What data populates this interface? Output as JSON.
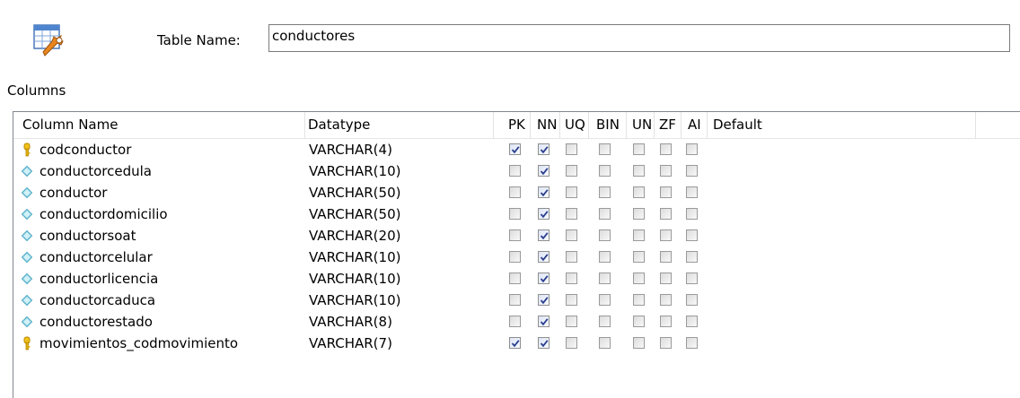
{
  "table": {
    "name_label": "Table Name:",
    "name_value": "conductores",
    "icon": "table-edit-icon"
  },
  "columns": {
    "section_label": "Columns",
    "headers": {
      "column_name": "Column Name",
      "datatype": "Datatype",
      "pk": "PK",
      "nn": "NN",
      "uq": "UQ",
      "bin": "BIN",
      "un": "UN",
      "zf": "ZF",
      "ai": "AI",
      "default": "Default"
    },
    "flag_keys": [
      "pk",
      "nn",
      "uq",
      "bin",
      "un",
      "zf",
      "ai"
    ],
    "rows": [
      {
        "name": "codconductor",
        "datatype": "VARCHAR(4)",
        "icon": "primary-key-icon",
        "flags": {
          "pk": true,
          "nn": true,
          "uq": false,
          "bin": false,
          "un": false,
          "zf": false,
          "ai": false
        },
        "default": ""
      },
      {
        "name": "conductorcedula",
        "datatype": "VARCHAR(10)",
        "icon": "column-diamond-icon",
        "flags": {
          "pk": false,
          "nn": true,
          "uq": false,
          "bin": false,
          "un": false,
          "zf": false,
          "ai": false
        },
        "default": ""
      },
      {
        "name": "conductor",
        "datatype": "VARCHAR(50)",
        "icon": "column-diamond-icon",
        "flags": {
          "pk": false,
          "nn": true,
          "uq": false,
          "bin": false,
          "un": false,
          "zf": false,
          "ai": false
        },
        "default": ""
      },
      {
        "name": "conductordomicilio",
        "datatype": "VARCHAR(50)",
        "icon": "column-diamond-icon",
        "flags": {
          "pk": false,
          "nn": true,
          "uq": false,
          "bin": false,
          "un": false,
          "zf": false,
          "ai": false
        },
        "default": ""
      },
      {
        "name": "conductorsoat",
        "datatype": "VARCHAR(20)",
        "icon": "column-diamond-icon",
        "flags": {
          "pk": false,
          "nn": true,
          "uq": false,
          "bin": false,
          "un": false,
          "zf": false,
          "ai": false
        },
        "default": ""
      },
      {
        "name": "conductorcelular",
        "datatype": "VARCHAR(10)",
        "icon": "column-diamond-icon",
        "flags": {
          "pk": false,
          "nn": true,
          "uq": false,
          "bin": false,
          "un": false,
          "zf": false,
          "ai": false
        },
        "default": ""
      },
      {
        "name": "conductorlicencia",
        "datatype": "VARCHAR(10)",
        "icon": "column-diamond-icon",
        "flags": {
          "pk": false,
          "nn": true,
          "uq": false,
          "bin": false,
          "un": false,
          "zf": false,
          "ai": false
        },
        "default": ""
      },
      {
        "name": "conductorcaduca",
        "datatype": "VARCHAR(10)",
        "icon": "column-diamond-icon",
        "flags": {
          "pk": false,
          "nn": true,
          "uq": false,
          "bin": false,
          "un": false,
          "zf": false,
          "ai": false
        },
        "default": ""
      },
      {
        "name": "conductorestado",
        "datatype": "VARCHAR(8)",
        "icon": "column-diamond-icon",
        "flags": {
          "pk": false,
          "nn": true,
          "uq": false,
          "bin": false,
          "un": false,
          "zf": false,
          "ai": false
        },
        "default": ""
      },
      {
        "name": "movimientos_codmovimiento",
        "datatype": "VARCHAR(7)",
        "icon": "primary-key-icon",
        "flags": {
          "pk": true,
          "nn": true,
          "uq": false,
          "bin": false,
          "un": false,
          "zf": false,
          "ai": false
        },
        "default": ""
      }
    ]
  },
  "colors": {
    "grid_border": "#828790",
    "key_icon": "#e2b20c",
    "diamond_icon": "#7fd3e4",
    "check_mark": "#2b3f8f"
  }
}
